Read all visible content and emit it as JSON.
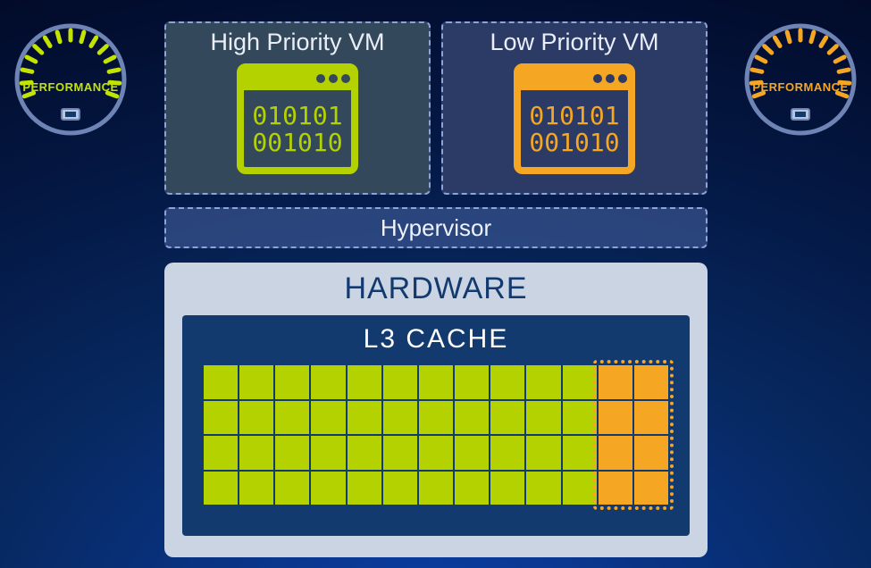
{
  "gauges": {
    "left": {
      "label": "PERFORMANCE",
      "color": "#c3e300",
      "ticks_lit": 15,
      "ticks_total": 15
    },
    "right": {
      "label": "PERFORMANCE",
      "color": "#f5a623",
      "ticks_lit": 15,
      "ticks_total": 15
    }
  },
  "vms": {
    "high": {
      "title": "High Priority VM",
      "code_line1": "010101",
      "code_line2": "001010",
      "accent": "#b4d200"
    },
    "low": {
      "title": "Low Priority VM",
      "code_line1": "010101",
      "code_line2": "001010",
      "accent": "#f5a623"
    }
  },
  "hypervisor": {
    "label": "Hypervisor"
  },
  "hardware": {
    "title": "HARDWARE",
    "cache": {
      "title": "L3 CACHE",
      "rows": 4,
      "cols": 13,
      "hp_cols": 11,
      "lp_cols": 2,
      "hp_color": "#b4d200",
      "lp_color": "#f5a623"
    }
  },
  "chart_data": {
    "type": "table",
    "title": "L3 Cache way allocation",
    "categories": [
      "High Priority VM",
      "Low Priority VM"
    ],
    "values": [
      11,
      2
    ],
    "rows": 4,
    "total_cols": 13
  }
}
